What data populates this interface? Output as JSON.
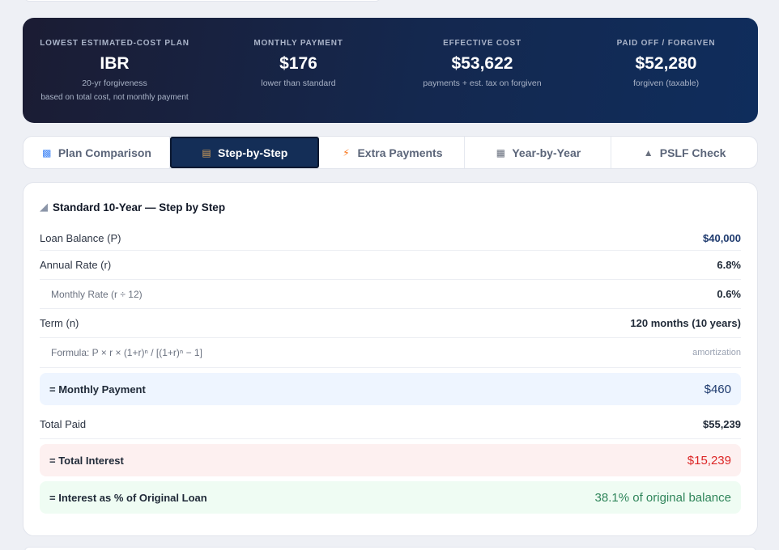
{
  "hero": {
    "stats": [
      {
        "label": "LOWEST ESTIMATED-COST PLAN",
        "value": "IBR",
        "sub": "20-yr forgiveness",
        "sub2": "based on total cost, not monthly payment"
      },
      {
        "label": "MONTHLY PAYMENT",
        "value": "$176",
        "sub": "lower than standard"
      },
      {
        "label": "EFFECTIVE COST",
        "value": "$53,622",
        "sub": "payments + est. tax on forgiven"
      },
      {
        "label": "PAID OFF / FORGIVEN",
        "value": "$52,280",
        "sub": "forgiven (taxable)"
      }
    ]
  },
  "tabs": [
    {
      "label": "Plan Comparison",
      "icon": "chart-icon"
    },
    {
      "label": "Step-by-Step",
      "icon": "clipboard-icon",
      "active": true
    },
    {
      "label": "Extra Payments",
      "icon": "bolt-icon"
    },
    {
      "label": "Year-by-Year",
      "icon": "calendar-icon"
    },
    {
      "label": "PSLF Check",
      "icon": "bank-icon"
    }
  ],
  "panel": {
    "title": "Standard 10-Year — Step by Step",
    "rows": {
      "loan_balance": {
        "label": "Loan Balance (P)",
        "value": "$40,000"
      },
      "annual_rate": {
        "label": "Annual Rate (r)",
        "value": "6.8%"
      },
      "monthly_rate": {
        "label": "Monthly Rate (r ÷ 12)",
        "value": "0.6%"
      },
      "term": {
        "label": "Term (n)",
        "value": "120 months (10 years)"
      },
      "formula": {
        "label": "Formula: P × r × (1+r)ⁿ / [(1+r)ⁿ − 1]",
        "value": "amortization"
      },
      "monthly_payment": {
        "label": "= Monthly Payment",
        "value": "$460"
      },
      "total_paid": {
        "label": "Total Paid",
        "value": "$55,239"
      },
      "total_interest": {
        "label": "= Total Interest",
        "value": "$15,239"
      },
      "interest_pct": {
        "label": "= Interest as % of Original Loan",
        "value": "38.1% of original balance"
      }
    }
  },
  "colors": {
    "hero_start": "#1b1c33",
    "hero_end": "#0f2d5c",
    "active_tab": "#142e57",
    "interest_red": "#dc2626",
    "pct_green": "#2f855a"
  }
}
